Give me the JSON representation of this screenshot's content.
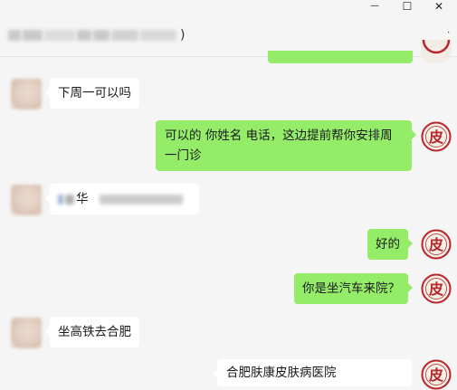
{
  "window": {
    "title_suffix": ")",
    "minimize": "—",
    "maximize": "☐",
    "close": "✕",
    "more": "•••"
  },
  "colors": {
    "sent_bubble": "#95ec69",
    "received_bubble": "#ffffff",
    "background": "#f5f5f5",
    "hospital_logo": "#b8242a"
  },
  "messages": [
    {
      "side": "left",
      "sender": "patient",
      "text": "下周一可以吗"
    },
    {
      "side": "right",
      "sender": "hospital",
      "text_line1": "可以的  你姓名 电话，这边提前帮你安排周",
      "text_line2": "一门诊"
    },
    {
      "side": "left",
      "sender": "patient",
      "text": "华"
    },
    {
      "side": "right",
      "sender": "hospital",
      "text": "好的"
    },
    {
      "side": "right",
      "sender": "hospital",
      "text": "你是坐汽车来院？"
    },
    {
      "side": "left",
      "sender": "patient",
      "text": "坐高铁去合肥"
    },
    {
      "side": "right",
      "sender": "hospital",
      "text": "合肥肤康皮肤病医院"
    }
  ],
  "logo_char": "皮"
}
